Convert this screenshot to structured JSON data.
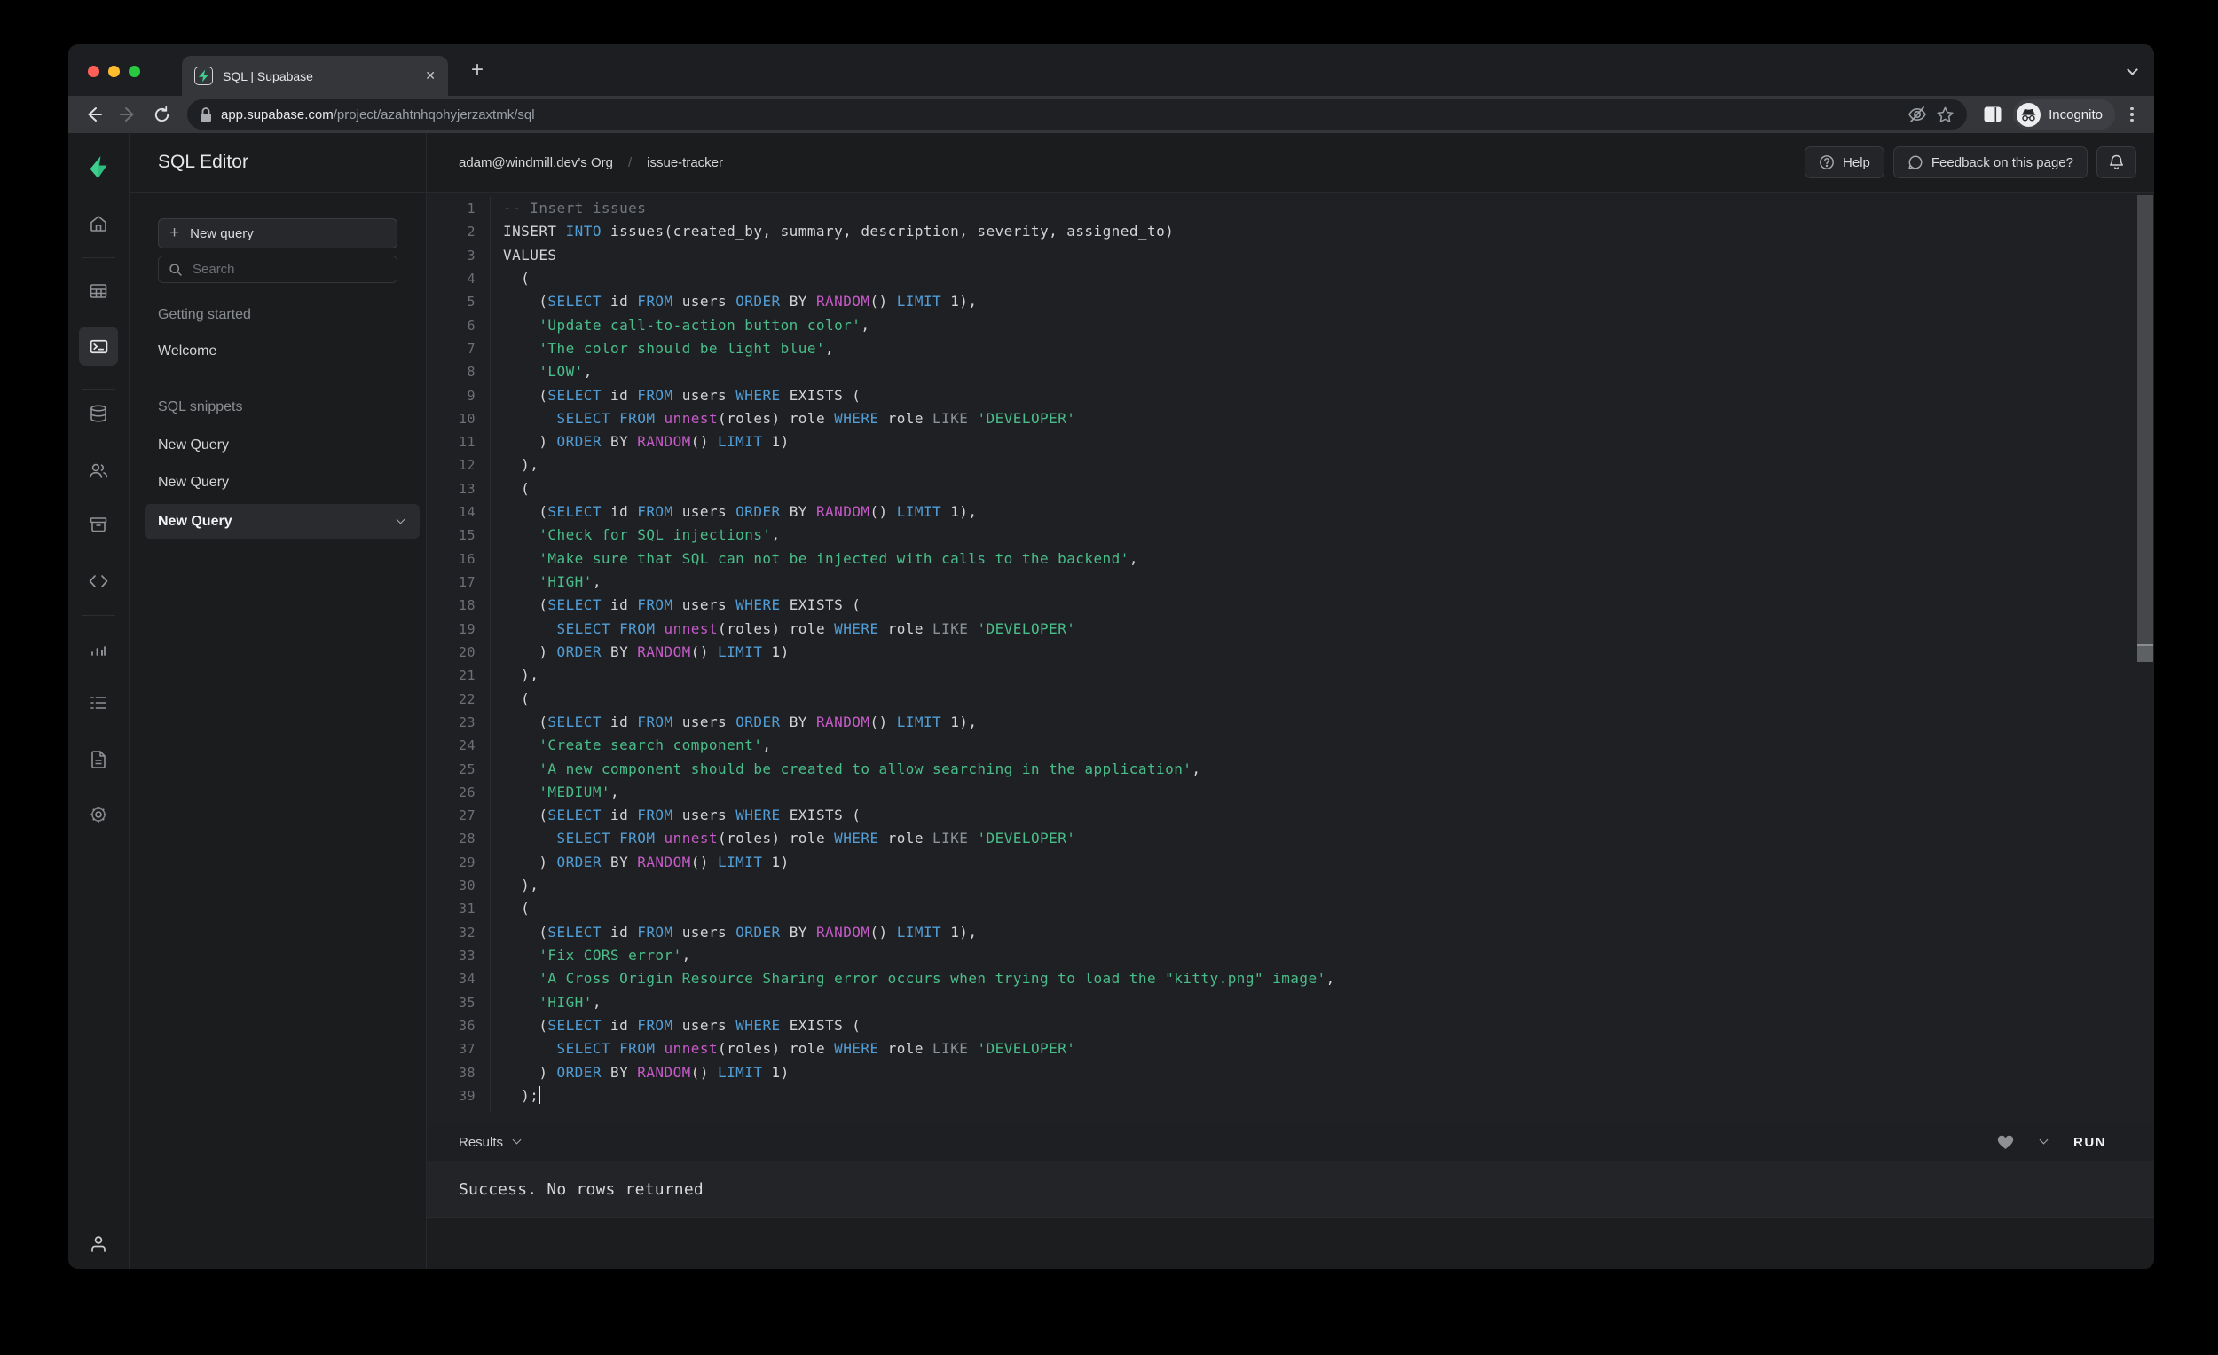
{
  "browser": {
    "tab": {
      "title": "SQL | Supabase",
      "close_glyph": "✕"
    },
    "new_tab_glyph": "+",
    "url": {
      "host": "app.supabase.com",
      "path": "/project/azahtnhqohyjerzaxtmk/sql"
    },
    "incognito_label": "Incognito",
    "icons": [
      "back-icon",
      "forward-icon",
      "reload-icon",
      "lock-icon",
      "eye-off-icon",
      "star-icon",
      "side-panel-icon",
      "incognito-icon",
      "menu-dots-icon",
      "tab-search-chevron-icon"
    ]
  },
  "colors": {
    "accent_green": "#3ECF8E",
    "traffic_red": "#FF5F57",
    "traffic_yellow": "#FEBC2E",
    "traffic_green": "#28C840",
    "syntax_keyword": "#519ED7",
    "syntax_function": "#C75AC9",
    "syntax_string": "#49BE8A",
    "syntax_comment": "#72777D",
    "syntax_operator": "#8C9398",
    "syntax_default": "#D4D4D6"
  },
  "app": {
    "rail_icons": [
      "supabase-logo",
      "home-icon",
      "table-editor-icon",
      "sql-editor-icon",
      "database-icon",
      "auth-users-icon",
      "storage-icon",
      "api-code-icon",
      "reports-icon",
      "logs-icon",
      "docs-icon",
      "settings-icon",
      "account-icon"
    ],
    "query_panel": {
      "title": "SQL Editor",
      "new_query_button": "New query",
      "search_placeholder": "Search",
      "sections": [
        {
          "label": "Getting started",
          "items": [
            {
              "label": "Welcome"
            }
          ]
        },
        {
          "label": "SQL snippets",
          "items": [
            {
              "label": "New Query"
            },
            {
              "label": "New Query"
            },
            {
              "label": "New Query"
            }
          ]
        }
      ]
    },
    "header": {
      "org": "adam@windmill.dev's Org",
      "separator": "/",
      "project": "issue-tracker",
      "help_button": "Help",
      "feedback_button": "Feedback on this page?"
    },
    "editor": {
      "lines": [
        [
          [
            "c",
            "-- Insert issues"
          ]
        ],
        [
          [
            "w",
            "INSERT "
          ],
          [
            "k",
            "INTO"
          ],
          [
            "w",
            " issues(created_by, summary, description, severity, assigned_to)"
          ]
        ],
        [
          [
            "w",
            "VALUES"
          ]
        ],
        [
          [
            "w",
            "  ("
          ]
        ],
        [
          [
            "w",
            "    ("
          ],
          [
            "k",
            "SELECT"
          ],
          [
            "w",
            " id "
          ],
          [
            "k",
            "FROM"
          ],
          [
            "w",
            " users "
          ],
          [
            "k",
            "ORDER"
          ],
          [
            "w",
            " BY "
          ],
          [
            "f",
            "RANDOM"
          ],
          [
            "w",
            "() "
          ],
          [
            "k",
            "LIMIT"
          ],
          [
            "w",
            " 1),"
          ]
        ],
        [
          [
            "w",
            "    "
          ],
          [
            "s",
            "'Update call-to-action button color'"
          ],
          [
            "w",
            ","
          ]
        ],
        [
          [
            "w",
            "    "
          ],
          [
            "s",
            "'The color should be light blue'"
          ],
          [
            "w",
            ","
          ]
        ],
        [
          [
            "w",
            "    "
          ],
          [
            "s",
            "'LOW'"
          ],
          [
            "w",
            ","
          ]
        ],
        [
          [
            "w",
            "    ("
          ],
          [
            "k",
            "SELECT"
          ],
          [
            "w",
            " id "
          ],
          [
            "k",
            "FROM"
          ],
          [
            "w",
            " users "
          ],
          [
            "k",
            "WHERE"
          ],
          [
            "w",
            " EXISTS ("
          ]
        ],
        [
          [
            "w",
            "      "
          ],
          [
            "k",
            "SELECT"
          ],
          [
            "w",
            " "
          ],
          [
            "k",
            "FROM"
          ],
          [
            "w",
            " "
          ],
          [
            "f",
            "unnest"
          ],
          [
            "w",
            "(roles) role "
          ],
          [
            "k",
            "WHERE"
          ],
          [
            "w",
            " role "
          ],
          [
            "o",
            "LIKE"
          ],
          [
            "w",
            " "
          ],
          [
            "s",
            "'DEVELOPER'"
          ]
        ],
        [
          [
            "w",
            "    ) "
          ],
          [
            "k",
            "ORDER"
          ],
          [
            "w",
            " BY "
          ],
          [
            "f",
            "RANDOM"
          ],
          [
            "w",
            "() "
          ],
          [
            "k",
            "LIMIT"
          ],
          [
            "w",
            " 1)"
          ]
        ],
        [
          [
            "w",
            "  ),"
          ]
        ],
        [
          [
            "w",
            "  ("
          ]
        ],
        [
          [
            "w",
            "    ("
          ],
          [
            "k",
            "SELECT"
          ],
          [
            "w",
            " id "
          ],
          [
            "k",
            "FROM"
          ],
          [
            "w",
            " users "
          ],
          [
            "k",
            "ORDER"
          ],
          [
            "w",
            " BY "
          ],
          [
            "f",
            "RANDOM"
          ],
          [
            "w",
            "() "
          ],
          [
            "k",
            "LIMIT"
          ],
          [
            "w",
            " 1),"
          ]
        ],
        [
          [
            "w",
            "    "
          ],
          [
            "s",
            "'Check for SQL injections'"
          ],
          [
            "w",
            ","
          ]
        ],
        [
          [
            "w",
            "    "
          ],
          [
            "s",
            "'Make sure that SQL can not be injected with calls to the backend'"
          ],
          [
            "w",
            ","
          ]
        ],
        [
          [
            "w",
            "    "
          ],
          [
            "s",
            "'HIGH'"
          ],
          [
            "w",
            ","
          ]
        ],
        [
          [
            "w",
            "    ("
          ],
          [
            "k",
            "SELECT"
          ],
          [
            "w",
            " id "
          ],
          [
            "k",
            "FROM"
          ],
          [
            "w",
            " users "
          ],
          [
            "k",
            "WHERE"
          ],
          [
            "w",
            " EXISTS ("
          ]
        ],
        [
          [
            "w",
            "      "
          ],
          [
            "k",
            "SELECT"
          ],
          [
            "w",
            " "
          ],
          [
            "k",
            "FROM"
          ],
          [
            "w",
            " "
          ],
          [
            "f",
            "unnest"
          ],
          [
            "w",
            "(roles) role "
          ],
          [
            "k",
            "WHERE"
          ],
          [
            "w",
            " role "
          ],
          [
            "o",
            "LIKE"
          ],
          [
            "w",
            " "
          ],
          [
            "s",
            "'DEVELOPER'"
          ]
        ],
        [
          [
            "w",
            "    ) "
          ],
          [
            "k",
            "ORDER"
          ],
          [
            "w",
            " BY "
          ],
          [
            "f",
            "RANDOM"
          ],
          [
            "w",
            "() "
          ],
          [
            "k",
            "LIMIT"
          ],
          [
            "w",
            " 1)"
          ]
        ],
        [
          [
            "w",
            "  ),"
          ]
        ],
        [
          [
            "w",
            "  ("
          ]
        ],
        [
          [
            "w",
            "    ("
          ],
          [
            "k",
            "SELECT"
          ],
          [
            "w",
            " id "
          ],
          [
            "k",
            "FROM"
          ],
          [
            "w",
            " users "
          ],
          [
            "k",
            "ORDER"
          ],
          [
            "w",
            " BY "
          ],
          [
            "f",
            "RANDOM"
          ],
          [
            "w",
            "() "
          ],
          [
            "k",
            "LIMIT"
          ],
          [
            "w",
            " 1),"
          ]
        ],
        [
          [
            "w",
            "    "
          ],
          [
            "s",
            "'Create search component'"
          ],
          [
            "w",
            ","
          ]
        ],
        [
          [
            "w",
            "    "
          ],
          [
            "s",
            "'A new component should be created to allow searching in the application'"
          ],
          [
            "w",
            ","
          ]
        ],
        [
          [
            "w",
            "    "
          ],
          [
            "s",
            "'MEDIUM'"
          ],
          [
            "w",
            ","
          ]
        ],
        [
          [
            "w",
            "    ("
          ],
          [
            "k",
            "SELECT"
          ],
          [
            "w",
            " id "
          ],
          [
            "k",
            "FROM"
          ],
          [
            "w",
            " users "
          ],
          [
            "k",
            "WHERE"
          ],
          [
            "w",
            " EXISTS ("
          ]
        ],
        [
          [
            "w",
            "      "
          ],
          [
            "k",
            "SELECT"
          ],
          [
            "w",
            " "
          ],
          [
            "k",
            "FROM"
          ],
          [
            "w",
            " "
          ],
          [
            "f",
            "unnest"
          ],
          [
            "w",
            "(roles) role "
          ],
          [
            "k",
            "WHERE"
          ],
          [
            "w",
            " role "
          ],
          [
            "o",
            "LIKE"
          ],
          [
            "w",
            " "
          ],
          [
            "s",
            "'DEVELOPER'"
          ]
        ],
        [
          [
            "w",
            "    ) "
          ],
          [
            "k",
            "ORDER"
          ],
          [
            "w",
            " BY "
          ],
          [
            "f",
            "RANDOM"
          ],
          [
            "w",
            "() "
          ],
          [
            "k",
            "LIMIT"
          ],
          [
            "w",
            " 1)"
          ]
        ],
        [
          [
            "w",
            "  ),"
          ]
        ],
        [
          [
            "w",
            "  ("
          ]
        ],
        [
          [
            "w",
            "    ("
          ],
          [
            "k",
            "SELECT"
          ],
          [
            "w",
            " id "
          ],
          [
            "k",
            "FROM"
          ],
          [
            "w",
            " users "
          ],
          [
            "k",
            "ORDER"
          ],
          [
            "w",
            " BY "
          ],
          [
            "f",
            "RANDOM"
          ],
          [
            "w",
            "() "
          ],
          [
            "k",
            "LIMIT"
          ],
          [
            "w",
            " 1),"
          ]
        ],
        [
          [
            "w",
            "    "
          ],
          [
            "s",
            "'Fix CORS error'"
          ],
          [
            "w",
            ","
          ]
        ],
        [
          [
            "w",
            "    "
          ],
          [
            "s",
            "'A Cross Origin Resource Sharing error occurs when trying to load the \"kitty.png\" image'"
          ],
          [
            "w",
            ","
          ]
        ],
        [
          [
            "w",
            "    "
          ],
          [
            "s",
            "'HIGH'"
          ],
          [
            "w",
            ","
          ]
        ],
        [
          [
            "w",
            "    ("
          ],
          [
            "k",
            "SELECT"
          ],
          [
            "w",
            " id "
          ],
          [
            "k",
            "FROM"
          ],
          [
            "w",
            " users "
          ],
          [
            "k",
            "WHERE"
          ],
          [
            "w",
            " EXISTS ("
          ]
        ],
        [
          [
            "w",
            "      "
          ],
          [
            "k",
            "SELECT"
          ],
          [
            "w",
            " "
          ],
          [
            "k",
            "FROM"
          ],
          [
            "w",
            " "
          ],
          [
            "f",
            "unnest"
          ],
          [
            "w",
            "(roles) role "
          ],
          [
            "k",
            "WHERE"
          ],
          [
            "w",
            " role "
          ],
          [
            "o",
            "LIKE"
          ],
          [
            "w",
            " "
          ],
          [
            "s",
            "'DEVELOPER'"
          ]
        ],
        [
          [
            "w",
            "    ) "
          ],
          [
            "k",
            "ORDER"
          ],
          [
            "w",
            " BY "
          ],
          [
            "f",
            "RANDOM"
          ],
          [
            "w",
            "() "
          ],
          [
            "k",
            "LIMIT"
          ],
          [
            "w",
            " 1)"
          ]
        ],
        [
          [
            "w",
            "  );"
          ]
        ]
      ]
    },
    "results": {
      "label": "Results",
      "run_button": "RUN",
      "message": "Success. No rows returned"
    }
  }
}
